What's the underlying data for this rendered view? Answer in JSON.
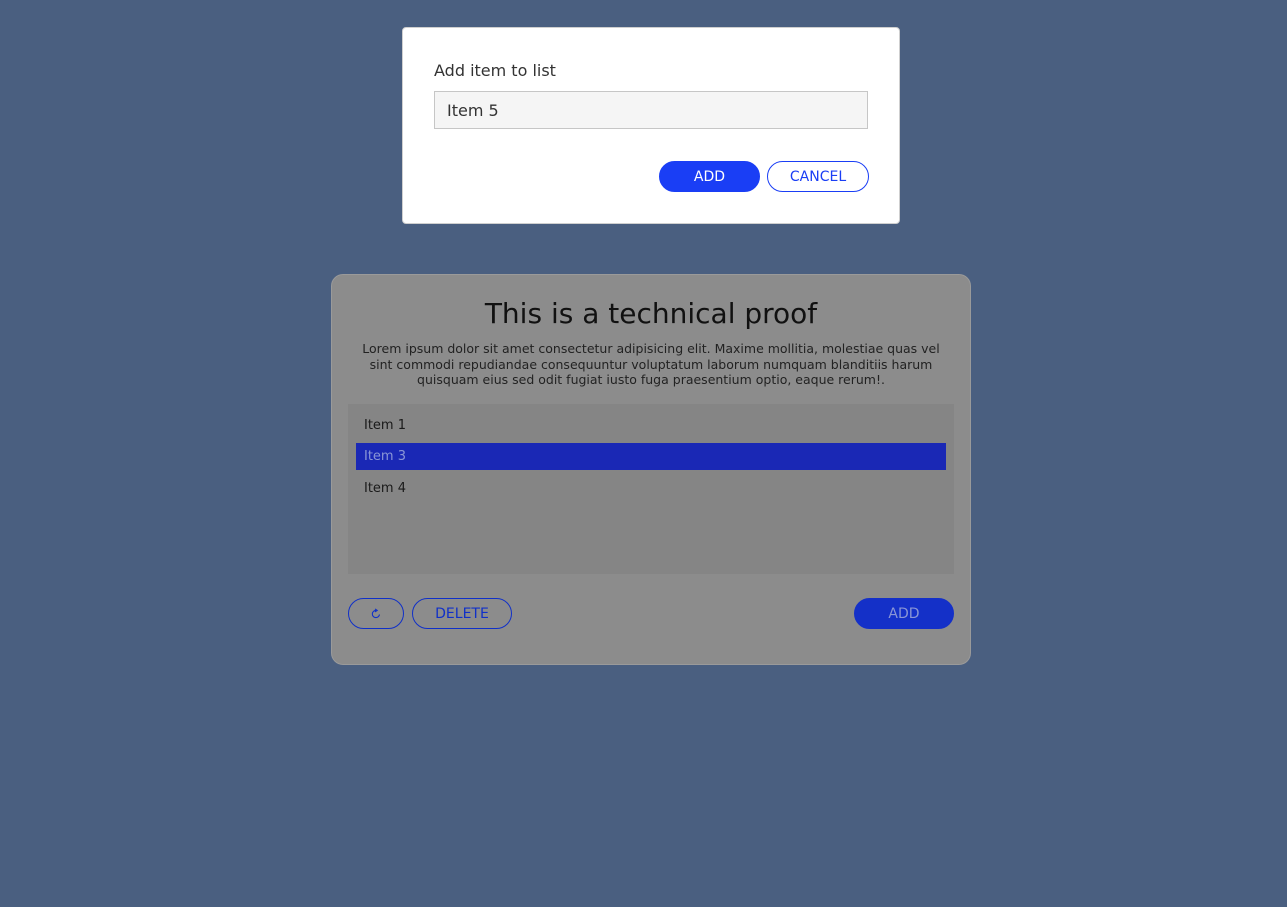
{
  "modal": {
    "title": "Add item to list",
    "input_value": "Item 5",
    "add_label": "ADD",
    "cancel_label": "CANCEL"
  },
  "card": {
    "title": "This is a technical proof",
    "description": "Lorem ipsum dolor sit amet consectetur adipisicing elit. Maxime mollitia, molestiae quas vel sint commodi repudiandae consequuntur voluptatum laborum numquam blanditiis harum quisquam eius sed odit fugiat iusto fuga praesentium optio, eaque rerum!.",
    "items": [
      {
        "label": "Item 1",
        "selected": false
      },
      {
        "label": "Item 3",
        "selected": true
      },
      {
        "label": "Item 4",
        "selected": false
      }
    ],
    "refresh_icon": "refresh-icon",
    "delete_label": "DELETE",
    "add_label": "ADD"
  },
  "colors": {
    "background": "#4a5f80",
    "accent": "#1a3ef5",
    "selected_row": "#1a28b5"
  }
}
